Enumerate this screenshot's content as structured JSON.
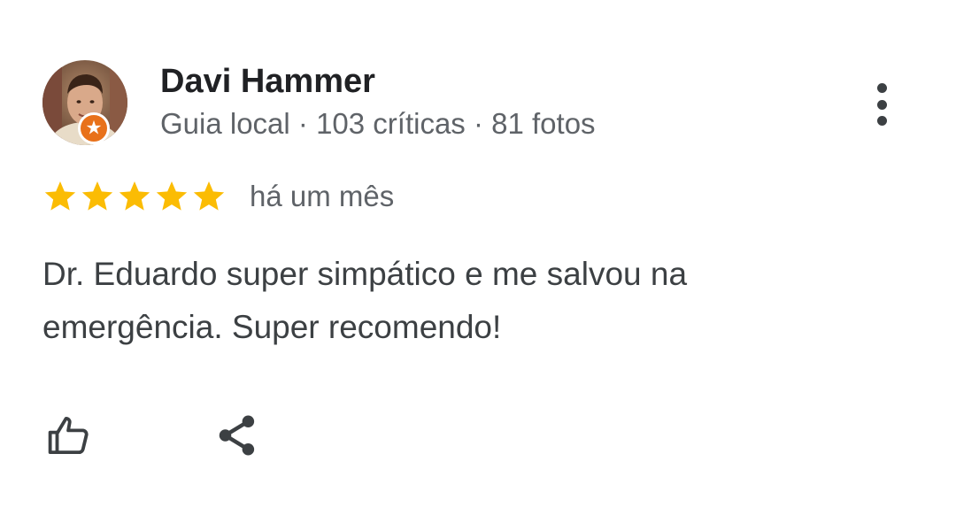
{
  "review": {
    "author": {
      "name": "Davi Hammer",
      "meta": "Guia local · 103 críticas · 81 fotos",
      "avatar_icon": "user-avatar-photo",
      "badge_icon": "local-guide-star-badge",
      "badge_color": "#e8711a"
    },
    "rating": 5,
    "rating_max": 5,
    "star_color": "#fbbc04",
    "date": "há um mês",
    "text": "Dr. Eduardo super simpático e me salvou na emergência. Super recomendo!",
    "actions": {
      "like_icon": "thumbs-up-icon",
      "share_icon": "share-icon",
      "more_icon": "more-vertical-icon"
    }
  }
}
